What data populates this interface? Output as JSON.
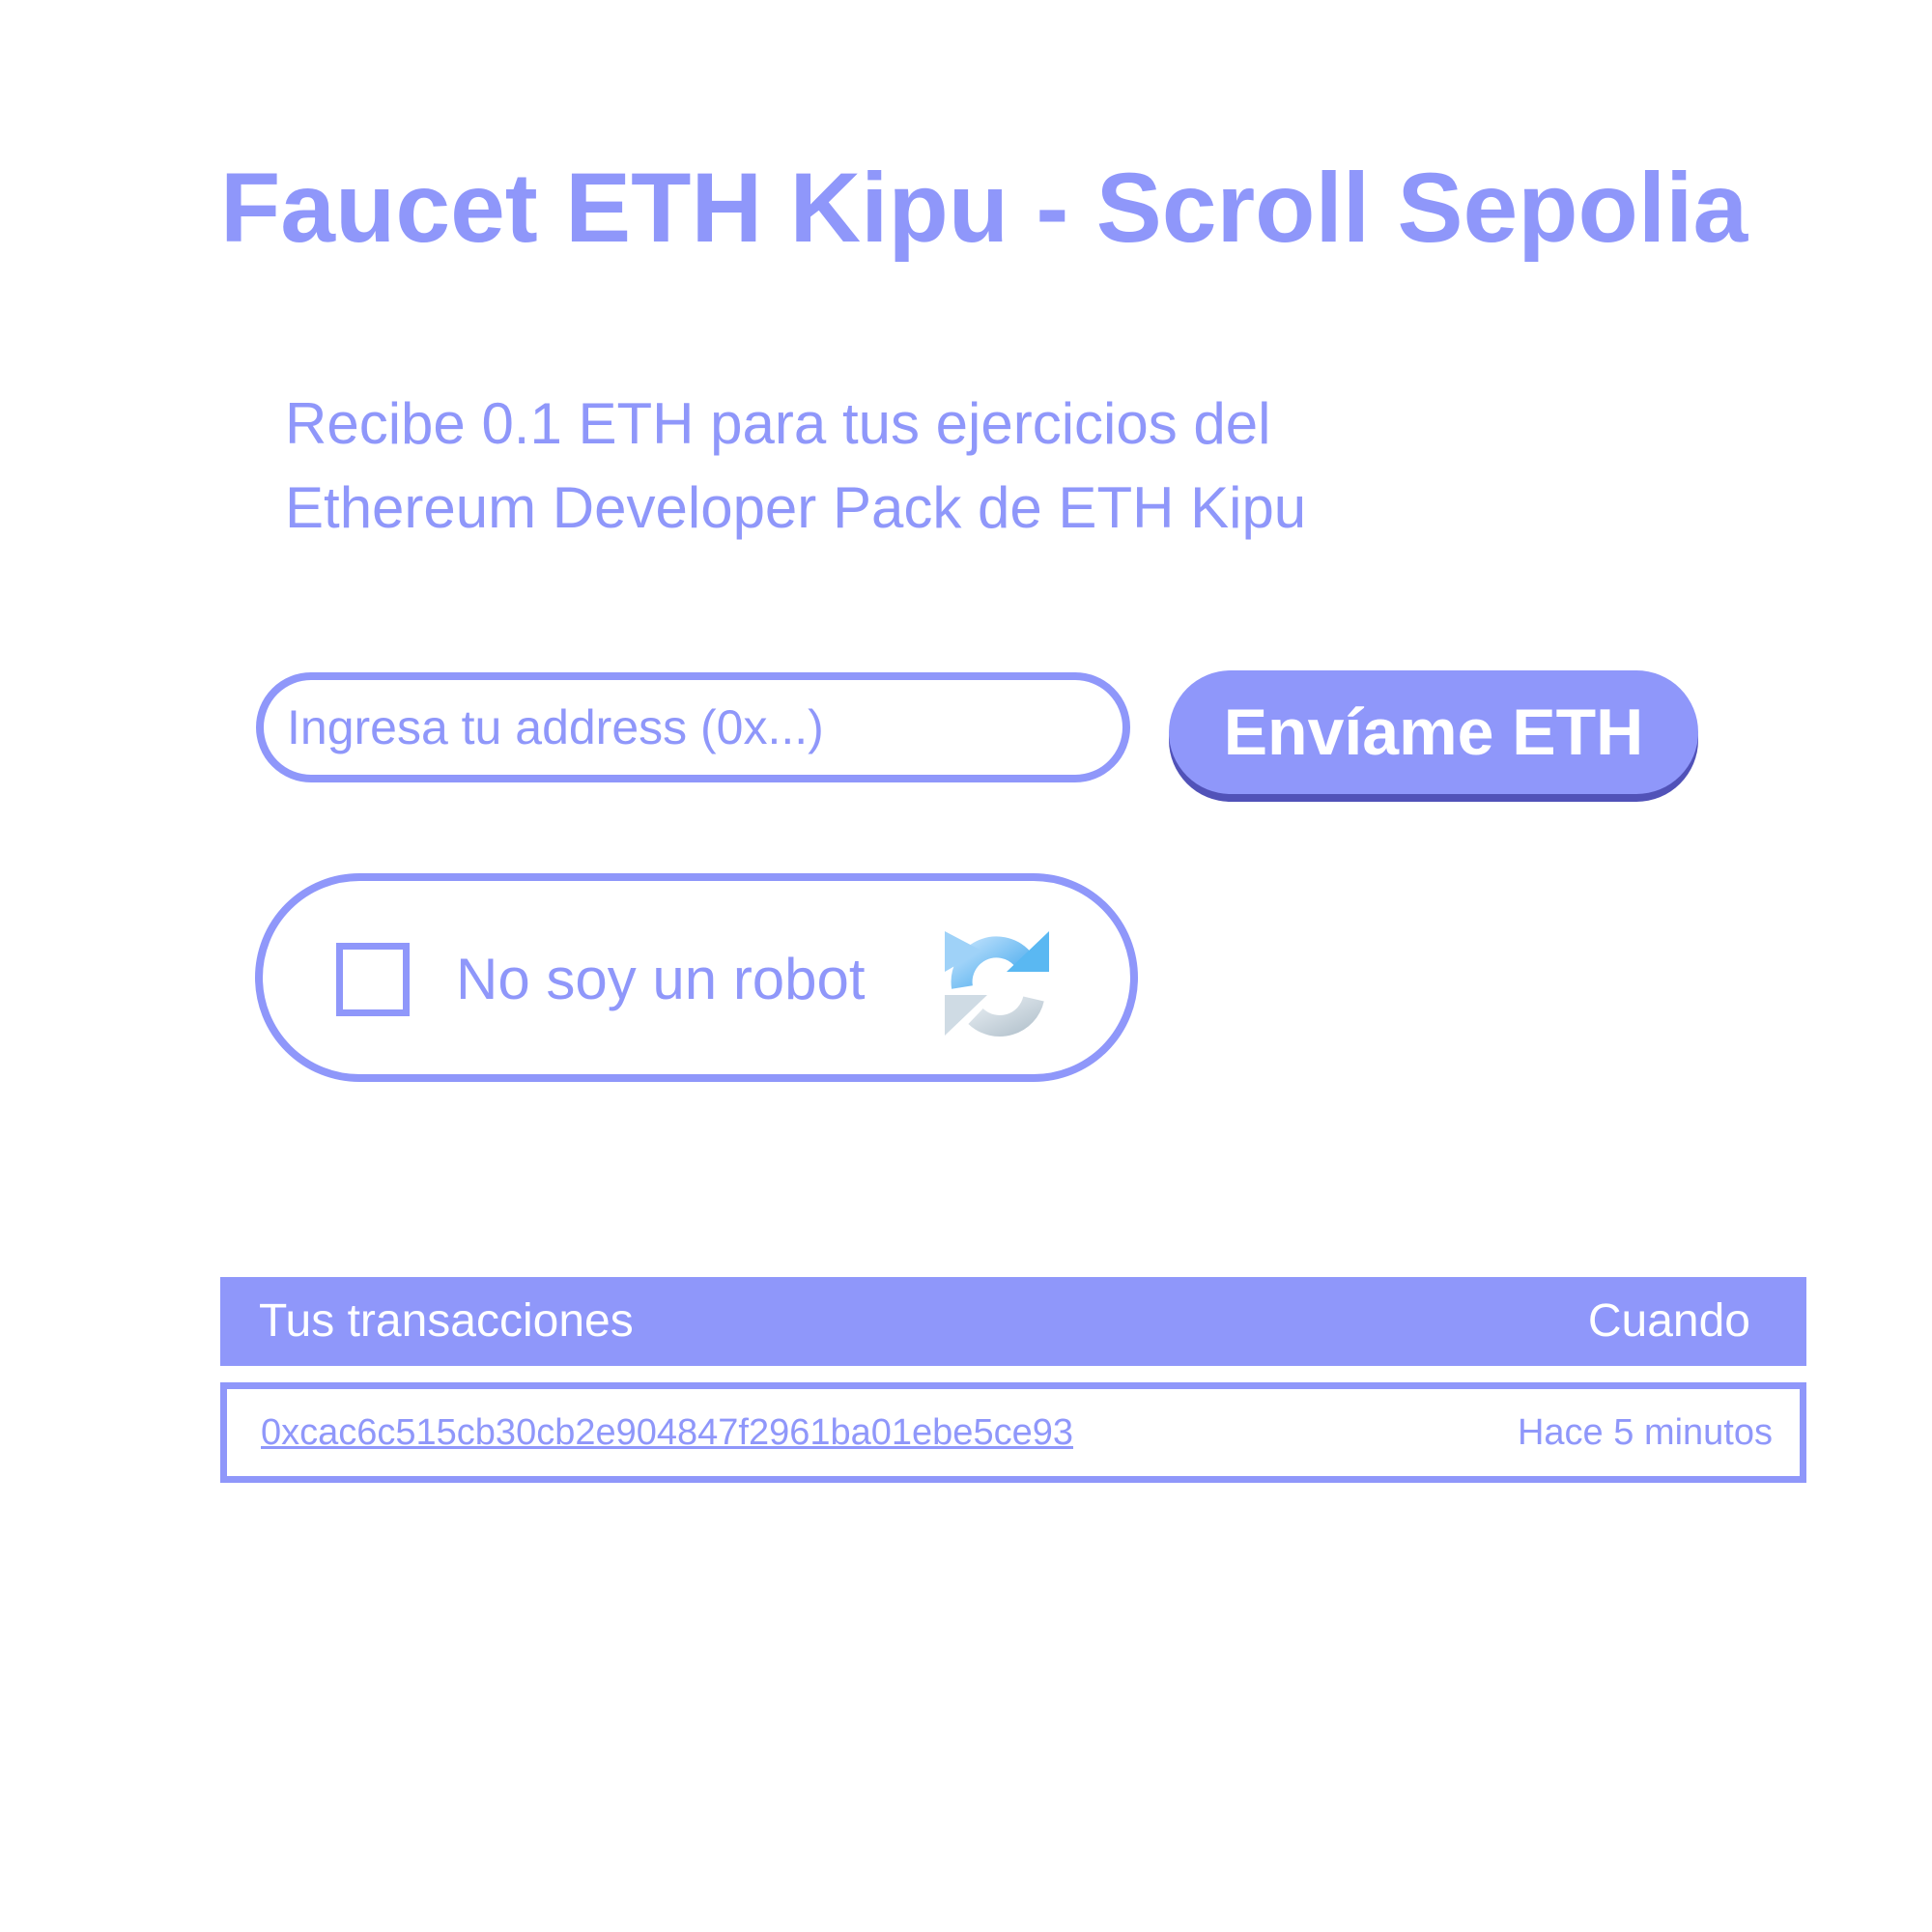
{
  "page": {
    "title": "Faucet ETH Kipu - Scroll Sepolia",
    "subtitle_line1": "Recibe 0.1 ETH para tus ejercicios del",
    "subtitle_line2": "Ethereum Developer Pack de ETH Kipu"
  },
  "form": {
    "address_placeholder": "Ingresa tu address (0x...)",
    "address_value": "",
    "send_button_label": "Envíame ETH"
  },
  "captcha": {
    "label": "No soy un robot",
    "checked": false,
    "icon": "recaptcha-icon"
  },
  "transactions": {
    "header_label": "Tus transacciones",
    "header_when": "Cuando",
    "rows": [
      {
        "hash": "0xcac6c515cb30cb2e904847f2961ba01ebe5ce93",
        "when": "Hace 5 minutos"
      }
    ]
  },
  "colors": {
    "accent": "#8f97fa",
    "button_shadow": "#5152b8",
    "background": "#ffffff"
  }
}
